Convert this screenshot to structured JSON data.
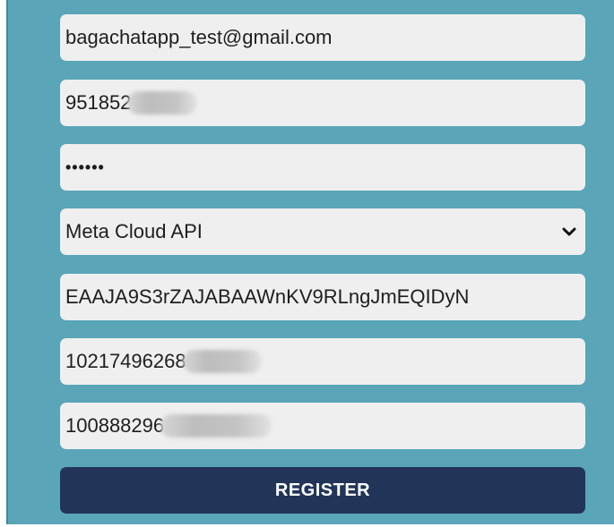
{
  "form": {
    "email": "bagachatapp_test@gmail.com",
    "phone_visible": "951852",
    "password_mask": "••••••",
    "provider_selected": "Meta Cloud API",
    "access_token": "EAAJA9S3rZAJABAAWnKV9RLngJmEQIDyN",
    "phone_number_id_visible": "10217496268",
    "business_account_id_visible": "100888296",
    "register_label": "REGISTER"
  },
  "icons": {
    "select_arrow": "chevron-down-icon"
  },
  "colors": {
    "background": "#5aa5b8",
    "field_bg": "#efefef",
    "button_bg": "#223558",
    "button_text": "#ffffff"
  }
}
